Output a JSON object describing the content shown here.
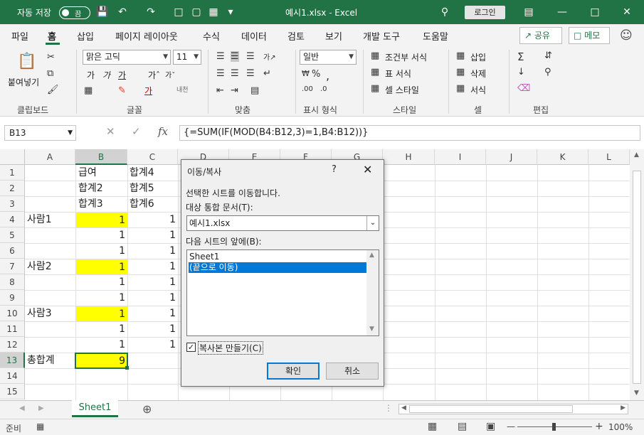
{
  "titlebar": {
    "autosave_label": "자동 저장",
    "autosave_state": "끔",
    "title": "예시1.xlsx  -  Excel",
    "login": "로그인"
  },
  "menu": {
    "items": [
      "파일",
      "홈",
      "삽입",
      "페이지 레이아웃",
      "수식",
      "데이터",
      "검토",
      "보기",
      "개발 도구",
      "도움말"
    ],
    "share": "공유",
    "memo": "메모"
  },
  "ribbon": {
    "paste": "붙여넣기",
    "font_name": "맑은 고딕",
    "font_size": "11",
    "number_format": "일반",
    "conditional_format": "조건부 서식",
    "table_format": "표 서식",
    "cell_style": "셀 스타일",
    "insert": "삽입",
    "delete": "삭제",
    "format": "서식",
    "groups": [
      "클립보드",
      "글꼴",
      "맞춤",
      "표시 형식",
      "스타일",
      "셀",
      "편집"
    ]
  },
  "formula_bar": {
    "name_box": "B13",
    "formula": "{=SUM(IF(MOD(B4:B12,3)=1,B4:B12))}"
  },
  "grid": {
    "columns": [
      "A",
      "B",
      "C",
      "D",
      "E",
      "F",
      "G",
      "H",
      "I",
      "J",
      "K",
      "L"
    ],
    "rows": [
      "1",
      "2",
      "3",
      "4",
      "5",
      "6",
      "7",
      "8",
      "9",
      "10",
      "11",
      "12",
      "13",
      "14",
      "15"
    ],
    "cells": {
      "B1": "급여",
      "C1": "합계4",
      "B2": "합계2",
      "C2": "합계5",
      "B3": "합계3",
      "C3": "합계6",
      "A4": "사람1",
      "B4": "1",
      "C4": "1",
      "B5": "1",
      "C5": "1",
      "B6": "1",
      "C6": "1",
      "A7": "사람2",
      "B7": "1",
      "C7": "1",
      "B8": "1",
      "C8": "1",
      "B9": "1",
      "C9": "1",
      "A10": "사람3",
      "B10": "1",
      "C10": "1",
      "B11": "1",
      "C11": "1",
      "B12": "1",
      "C12": "1",
      "A13": "총합계",
      "B13": "9"
    },
    "highlight_color": "#ffff00"
  },
  "sheets": {
    "tab": "Sheet1"
  },
  "status": {
    "ready": "준비",
    "zoom": "100%"
  },
  "dialog": {
    "title": "이동/복사",
    "help": "?",
    "line1": "선택한 시트를 이동합니다.",
    "target_label": "대상 통합 문서(T):",
    "target_value": "예시1.xlsx",
    "before_label": "다음 시트의 앞에(B):",
    "list": [
      "Sheet1",
      "(끝으로 이동)"
    ],
    "copy_label": "복사본 만들기(C)",
    "ok": "확인",
    "cancel": "취소"
  }
}
